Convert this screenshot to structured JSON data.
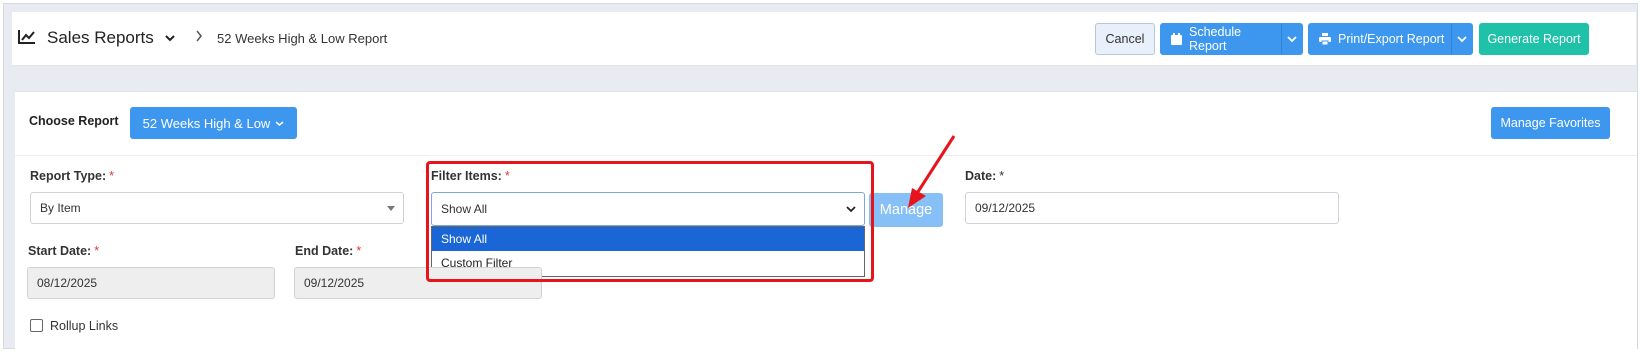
{
  "header": {
    "module_title": "Sales Reports",
    "current_report": "52 Weeks High & Low Report",
    "icons": {
      "module": "line-chart-icon",
      "module_menu": "chevron-down-icon",
      "separator": "chevron-right-icon"
    }
  },
  "toolbar": {
    "cancel_label": "Cancel",
    "schedule_label": "Schedule Report",
    "print_label": "Print/Export Report",
    "generate_label": "Generate Report",
    "icons": {
      "schedule": "calendar-icon",
      "print": "printer-icon",
      "dropdown": "chevron-down-icon"
    }
  },
  "choose_report": {
    "label": "Choose Report",
    "selected": "52 Weeks High & Low",
    "manage_favorites_label": "Manage Favorites"
  },
  "form": {
    "report_type": {
      "label": "Report Type:",
      "required_mark": "*",
      "value": "By Item"
    },
    "filter_items": {
      "label": "Filter Items:",
      "required_mark": "*",
      "value": "Show All",
      "options": [
        "Show All",
        "Custom Filter"
      ],
      "selected_index": 0,
      "manage_label": "Manage"
    },
    "date": {
      "label": "Date:",
      "required_mark": "*",
      "value": "09/12/2025"
    },
    "start_date": {
      "label": "Start Date:",
      "required_mark": "*",
      "value": "08/12/2025"
    },
    "end_date": {
      "label": "End Date:",
      "required_mark": "*",
      "value": "09/12/2025"
    },
    "rollup_links": {
      "label": "Rollup Links",
      "checked": false
    }
  },
  "colors": {
    "primary": "#3d97ee",
    "generate": "#1fc1a8",
    "manage_disabled": "#86c0f6",
    "annotation": "#e8141c",
    "option_selected": "#1a66d6",
    "required": "#e03a3a"
  }
}
